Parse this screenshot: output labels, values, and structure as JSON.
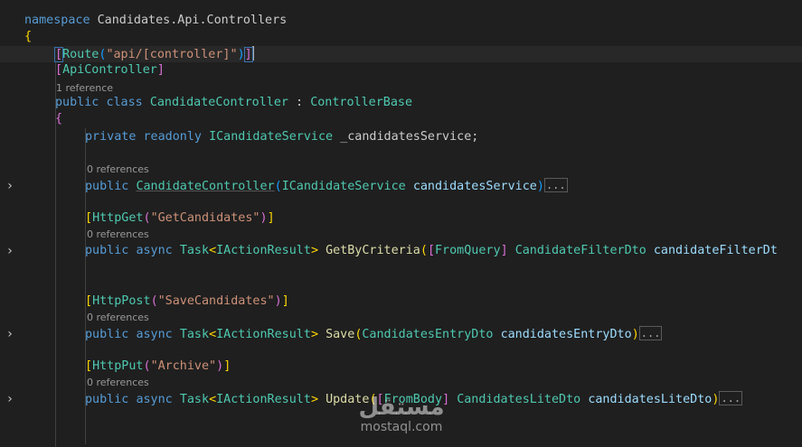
{
  "code": {
    "namespace": {
      "kw": "namespace",
      "name": "Candidates.Api.Controllers"
    },
    "ns_open": "{",
    "route": {
      "attr": "Route",
      "arg": "\"api/[controller]\""
    },
    "api_controller": {
      "attr": "ApiController"
    },
    "class_lens": "1 reference",
    "class_decl": {
      "kw1": "public",
      "kw2": "class",
      "name": "CandidateController",
      "sep": " : ",
      "base": "ControllerBase"
    },
    "class_open": "{",
    "field": {
      "kw1": "private",
      "kw2": "readonly",
      "type": "ICandidateService",
      "name": "_candidatesService;"
    },
    "ctor_lens": "0 references",
    "ctor": {
      "kw": "public",
      "name": "CandidateController",
      "ptype": "ICandidateService",
      "pname": "candidatesService"
    },
    "get_attr": {
      "attr": "HttpGet",
      "arg": "\"GetCandidates\""
    },
    "get_lens": "0 references",
    "get_method": {
      "kw1": "public",
      "kw2": "async",
      "type": "Task",
      "gtype": "IActionResult",
      "name": "GetByCriteria",
      "pattr": "FromQuery",
      "ptype": "CandidateFilterDto",
      "pname": "candidateFilterDt"
    },
    "post_attr": {
      "attr": "HttpPost",
      "arg": "\"SaveCandidates\""
    },
    "post_lens": "0 references",
    "post_method": {
      "kw1": "public",
      "kw2": "async",
      "type": "Task",
      "gtype": "IActionResult",
      "name": "Save",
      "ptype": "CandidatesEntryDto",
      "pname": "candidatesEntryDto"
    },
    "put_attr": {
      "attr": "HttpPut",
      "arg": "\"Archive\""
    },
    "put_lens": "0 references",
    "put_method": {
      "kw1": "public",
      "kw2": "async",
      "type": "Task",
      "gtype": "IActionResult",
      "name": "Update",
      "pattr": "FromBody",
      "ptype": "CandidatesLiteDto",
      "pname": "candidatesLiteDto"
    },
    "ellipsis": "..."
  },
  "folding": {
    "chevron": "›",
    "icon": "chevron-right-icon"
  },
  "watermark": {
    "logo": "مستقل",
    "text": "mostaql.com"
  },
  "colors": {
    "background": "#1f1f1f",
    "keyword": "#569cd6",
    "type": "#4ec9b0",
    "method": "#dcdcaa",
    "parameter": "#9cdcfe",
    "string": "#ce9178"
  }
}
